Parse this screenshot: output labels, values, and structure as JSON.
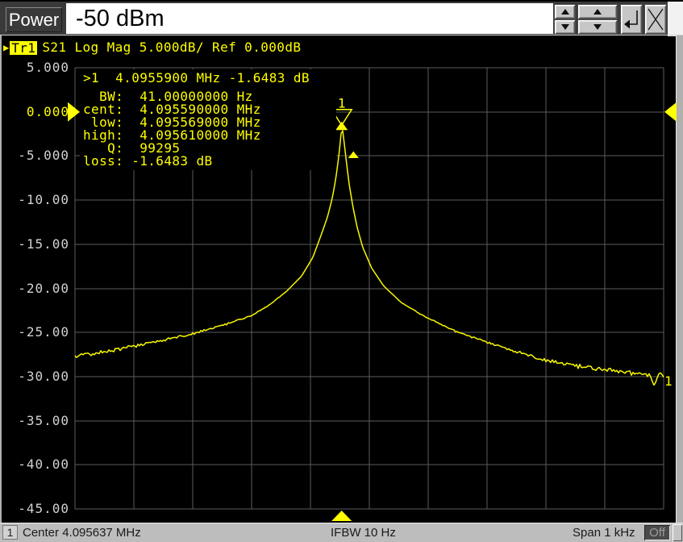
{
  "top_bar": {
    "power_label": "Power",
    "power_value": "-50 dBm"
  },
  "trace_header": {
    "active_marker_arrow": "▶",
    "trace_id": "Tr1",
    "settings_text": "S21 Log Mag 5.000dB/ Ref 0.000dB"
  },
  "marker_info": {
    "line1": ">1  4.0955900 MHz -1.6483 dB",
    "rows": [
      "  BW:  41.00000000 Hz",
      "cent:  4.095590000 MHz",
      " low:  4.095569000 MHz",
      "high:  4.095610000 MHz",
      "   Q:  99295",
      "loss: -1.6483 dB"
    ]
  },
  "chart_data": {
    "type": "line",
    "title": "S21 Log Mag response",
    "x_axis": {
      "center_label": "Center 4.095637 MHz",
      "span_label": "Span 1 kHz",
      "start_mhz": 4.095137,
      "stop_mhz": 4.096137,
      "span_hz": 1000,
      "divisions": 10,
      "hz_per_div": 100,
      "grid": true
    },
    "y_axis": {
      "unit": "dB",
      "ref_db": 0.0,
      "db_per_div": 5.0,
      "top_db": 5.0,
      "bottom_db": -45.0,
      "tick_labels": [
        "5.000",
        "0.000",
        "-5.000",
        "-10.00",
        "-15.00",
        "-20.00",
        "-25.00",
        "-30.00",
        "-35.00",
        "-40.00",
        "-45.00"
      ]
    },
    "trace": {
      "name": "Tr1",
      "parameter": "S21",
      "format": "Log Mag",
      "color": "#f8f800",
      "points_hz_db": [
        [
          0,
          -27.7
        ],
        [
          50,
          -27.2
        ],
        [
          100,
          -26.6
        ],
        [
          150,
          -25.9
        ],
        [
          200,
          -25.1
        ],
        [
          250,
          -24.2
        ],
        [
          300,
          -23.1
        ],
        [
          330,
          -21.9
        ],
        [
          360,
          -20.3
        ],
        [
          385,
          -18.6
        ],
        [
          404,
          -16.5
        ],
        [
          419,
          -13.8
        ],
        [
          429,
          -11.9
        ],
        [
          437,
          -9.8
        ],
        [
          443,
          -7.6
        ],
        [
          447,
          -5.6
        ],
        [
          450,
          -3.9
        ],
        [
          452,
          -2.5
        ],
        [
          453,
          -1.6483
        ],
        [
          455,
          -2.2
        ],
        [
          458,
          -3.9
        ],
        [
          462,
          -6.2
        ],
        [
          466,
          -8.3
        ],
        [
          472,
          -10.7
        ],
        [
          479,
          -13.0
        ],
        [
          489,
          -15.4
        ],
        [
          504,
          -17.7
        ],
        [
          524,
          -19.7
        ],
        [
          554,
          -21.6
        ],
        [
          594,
          -23.2
        ],
        [
          644,
          -24.8
        ],
        [
          694,
          -26.0
        ],
        [
          744,
          -27.1
        ],
        [
          794,
          -28.0
        ],
        [
          844,
          -28.7
        ],
        [
          894,
          -29.2
        ],
        [
          944,
          -29.6
        ],
        [
          975,
          -29.8
        ],
        [
          985,
          -31.2
        ],
        [
          992,
          -29.7
        ],
        [
          1000,
          -29.9
        ]
      ]
    },
    "markers": {
      "marker1": {
        "number": "1",
        "freq_mhz": 4.09559,
        "value_db": -1.6483
      },
      "bandwidth": {
        "bw_hz": 41.0,
        "cent_mhz": 4.09559,
        "low_mhz": 4.095569,
        "high_mhz": 4.09561,
        "q": 99295,
        "loss_db": -1.6483
      },
      "trace_end_label": "1"
    },
    "noise": {
      "seed": 9,
      "base_amp_db": 0.26,
      "quiet_radius_hz": 70,
      "ramp_hz": 380,
      "spike_prob": 0.06,
      "spike_scale": 2.0
    },
    "colors": {
      "trace": "#f8f800",
      "grid": "#5c5c5c",
      "marker": "#ffff00"
    }
  },
  "status_bar": {
    "channel": "1",
    "center_label": "Center 4.095637 MHz",
    "ifbw_label": "IFBW 10 Hz",
    "span_label": "Span 1 kHz",
    "off_label": "Off"
  }
}
